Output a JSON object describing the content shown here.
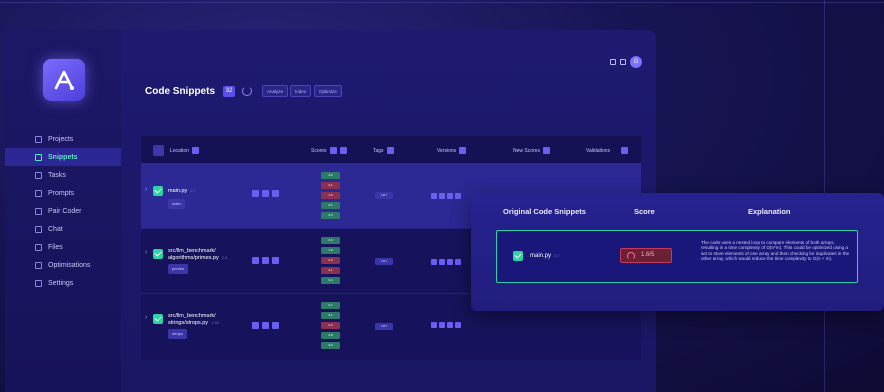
{
  "app": {
    "logo_letter": "A"
  },
  "sidebar": {
    "items": [
      {
        "label": "Projects",
        "icon": "folder-icon",
        "active": false
      },
      {
        "label": "Snippets",
        "icon": "code-icon",
        "active": true
      },
      {
        "label": "Tasks",
        "icon": "search-icon",
        "active": false
      },
      {
        "label": "Prompts",
        "icon": "grid-icon",
        "active": false
      },
      {
        "label": "Pair Coder",
        "icon": "pair-icon",
        "active": false
      },
      {
        "label": "Chat",
        "icon": "chat-icon",
        "active": false
      },
      {
        "label": "Files",
        "icon": "file-icon",
        "active": false
      },
      {
        "label": "Optimisations",
        "icon": "sliders-icon",
        "active": false
      },
      {
        "label": "Settings",
        "icon": "gear-icon",
        "active": false
      }
    ]
  },
  "header": {
    "title": "Code Snippets",
    "count": "32",
    "chips": [
      "Analyze",
      "Index",
      "Optimize"
    ],
    "avatar_initial": "G"
  },
  "table": {
    "columns": [
      "Location",
      "Scores",
      "Tags",
      "Versions",
      "New Scores",
      "Validations"
    ],
    "rows": [
      {
        "file": "main.py",
        "version": "3.7",
        "tag": "main",
        "scores": [
          "3.6",
          "2.1",
          "1.6",
          "3.1",
          "3.4"
        ],
        "score_colors": [
          "g",
          "r",
          "r",
          "g",
          "g"
        ],
        "tags_cell": "FMT"
      },
      {
        "file": "src/llm_benchmark/ algorithms/primes.py",
        "version": "2.8",
        "tag": "primes",
        "scores": [
          "3.0",
          "1.8",
          "2.0",
          "4.1",
          "3.4"
        ],
        "score_colors": [
          "g",
          "g",
          "r",
          "r",
          "g"
        ],
        "tags_cell": "FMT"
      },
      {
        "file": "src/llm_benchmark/ strings/strops.py",
        "version": "1.50",
        "tag": "strops",
        "scores": [
          "2.7",
          "3.1",
          "2.4",
          "4.8",
          "3.3"
        ],
        "score_colors": [
          "g",
          "g",
          "r",
          "g",
          "g"
        ],
        "tags_cell": "FMT"
      }
    ]
  },
  "popup": {
    "headers": [
      "Original Code Snippets",
      "Score",
      "Explanation"
    ],
    "file": "main.py",
    "version": "3.7",
    "score": "1.6/5",
    "explanation": "The code uses a nested loop to compare elements of both arrays, resulting in a time complexity of O(n*m). This could be optimized using a set to store elements of one array and then checking for duplicates in the other array, which would reduce the time complexity to O(n + m)."
  },
  "colors": {
    "accent": "#6a5ff0",
    "success": "#2dd4a3",
    "danger": "#c13b5d"
  }
}
